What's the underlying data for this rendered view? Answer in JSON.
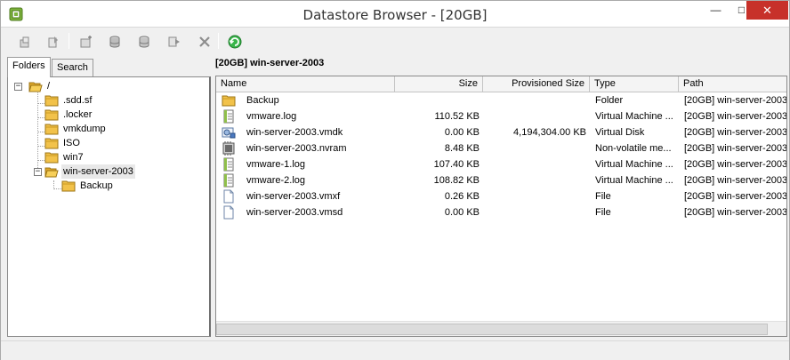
{
  "window": {
    "title": "Datastore Browser - [20GB]",
    "minimize": "—",
    "maximize": "□",
    "close": "✕"
  },
  "toolbar": {
    "items": [
      "upload-icon",
      "download-icon",
      "new-folder-icon",
      "datastore-icon",
      "datastore-alt-icon",
      "move-icon",
      "delete-icon",
      "refresh-icon"
    ]
  },
  "left": {
    "tabs": [
      {
        "label": "Folders",
        "active": true
      },
      {
        "label": "Search",
        "active": false
      }
    ],
    "tree": {
      "root": {
        "label": "/",
        "expander": "−"
      },
      "children": [
        {
          "label": ".sdd.sf"
        },
        {
          "label": ".locker"
        },
        {
          "label": "vmkdump"
        },
        {
          "label": "ISO"
        },
        {
          "label": "win7"
        },
        {
          "label": "win-server-2003",
          "expander": "−",
          "selected": true
        }
      ],
      "grandchildren": [
        {
          "label": "Backup"
        }
      ]
    }
  },
  "right": {
    "path": "[20GB] win-server-2003",
    "columns": [
      "Name",
      "Size",
      "Provisioned Size",
      "Type",
      "Path"
    ],
    "rows": [
      {
        "icon": "folder-icon",
        "name": "Backup",
        "size": "",
        "provisioned": "",
        "type": "Folder",
        "path": "[20GB] win-server-2003"
      },
      {
        "icon": "log-file-icon",
        "name": "vmware.log",
        "size": "110.52 KB",
        "provisioned": "",
        "type": "Virtual Machine ...",
        "path": "[20GB] win-server-2003"
      },
      {
        "icon": "virtual-disk-icon",
        "name": "win-server-2003.vmdk",
        "size": "0.00 KB",
        "provisioned": "4,194,304.00 KB",
        "type": "Virtual Disk",
        "path": "[20GB] win-server-2003"
      },
      {
        "icon": "nvram-icon",
        "name": "win-server-2003.nvram",
        "size": "8.48 KB",
        "provisioned": "",
        "type": "Non-volatile me...",
        "path": "[20GB] win-server-2003"
      },
      {
        "icon": "log-file-icon",
        "name": "vmware-1.log",
        "size": "107.40 KB",
        "provisioned": "",
        "type": "Virtual Machine ...",
        "path": "[20GB] win-server-2003"
      },
      {
        "icon": "log-file-icon",
        "name": "vmware-2.log",
        "size": "108.82 KB",
        "provisioned": "",
        "type": "Virtual Machine ...",
        "path": "[20GB] win-server-2003"
      },
      {
        "icon": "generic-file-icon",
        "name": "win-server-2003.vmxf",
        "size": "0.26 KB",
        "provisioned": "",
        "type": "File",
        "path": "[20GB] win-server-2003"
      },
      {
        "icon": "generic-file-icon",
        "name": "win-server-2003.vmsd",
        "size": "0.00 KB",
        "provisioned": "",
        "type": "File",
        "path": "[20GB] win-server-2003"
      }
    ]
  },
  "colors": {
    "close_button": "#c7312a",
    "folder": "#f2c24a",
    "refresh": "#2aa33a"
  }
}
